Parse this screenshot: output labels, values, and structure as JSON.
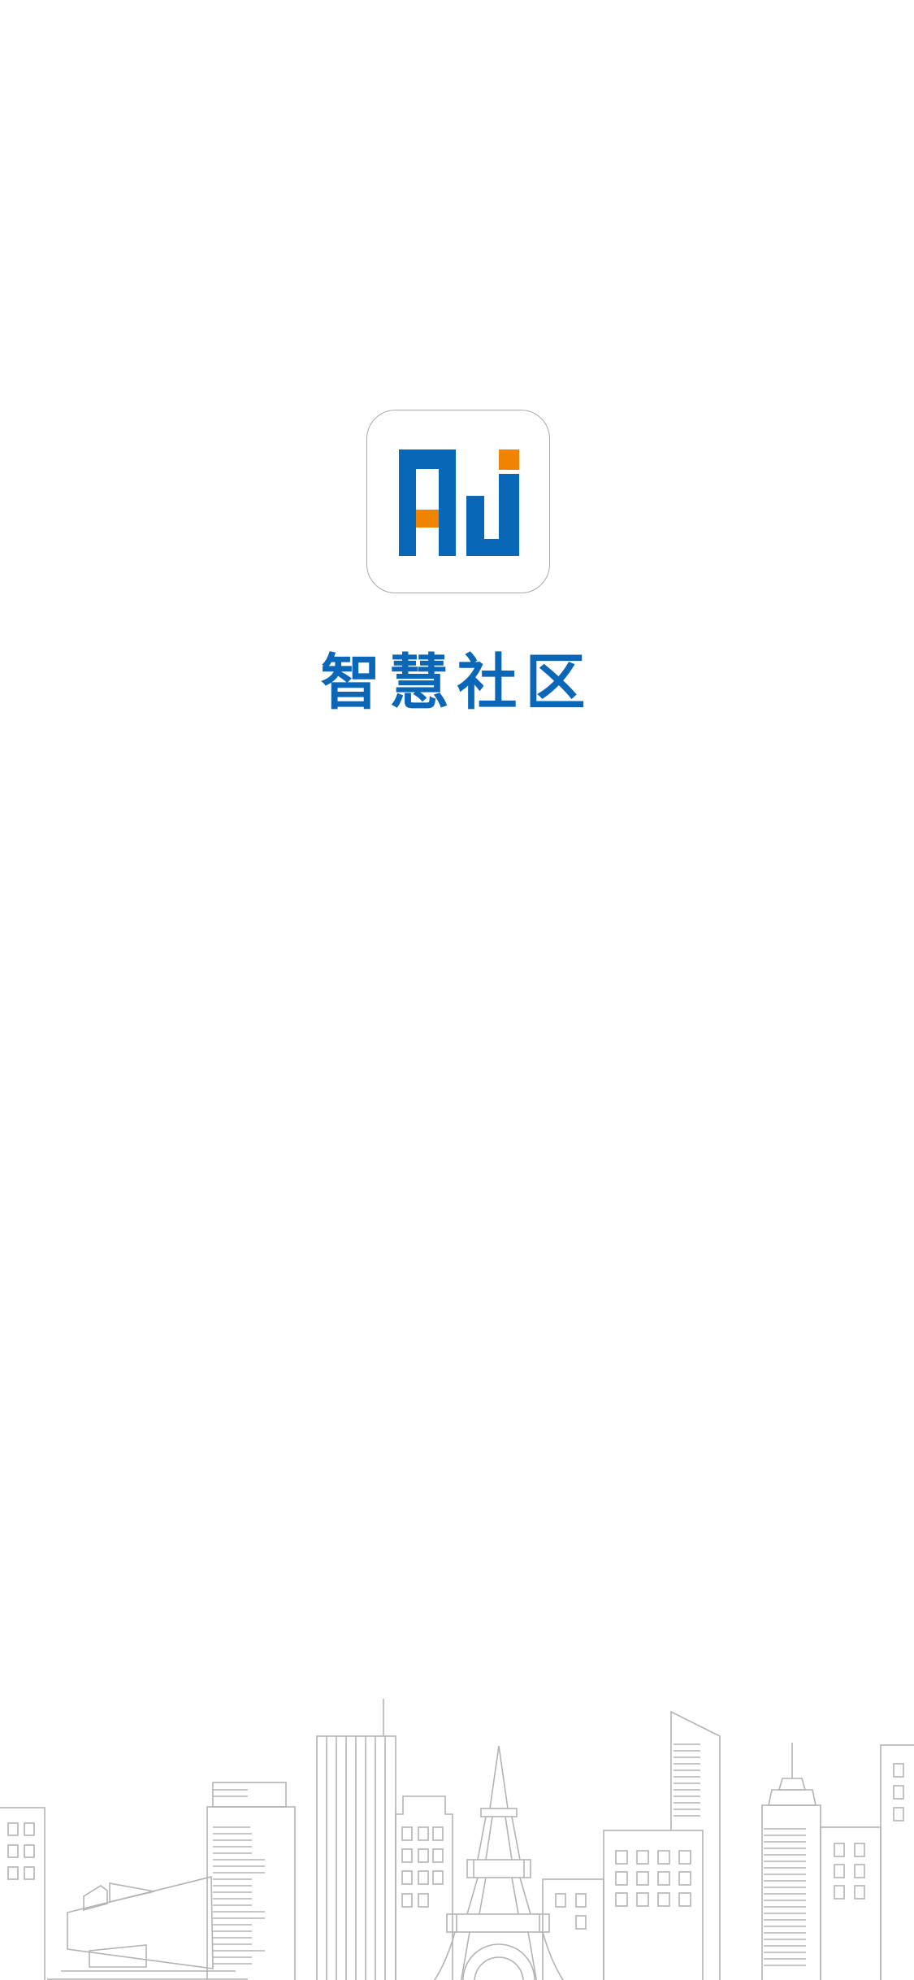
{
  "splash": {
    "app_name": "智慧社区",
    "logo_icon": "aj-logo-icon",
    "skyline_icon": "city-skyline-illustration"
  },
  "colors": {
    "background": "#ffffff",
    "brand_blue": "#0a67b8",
    "brand_orange": "#f08300",
    "line_gray": "#b3b3b3",
    "logo_border": "#a9a9a9"
  }
}
